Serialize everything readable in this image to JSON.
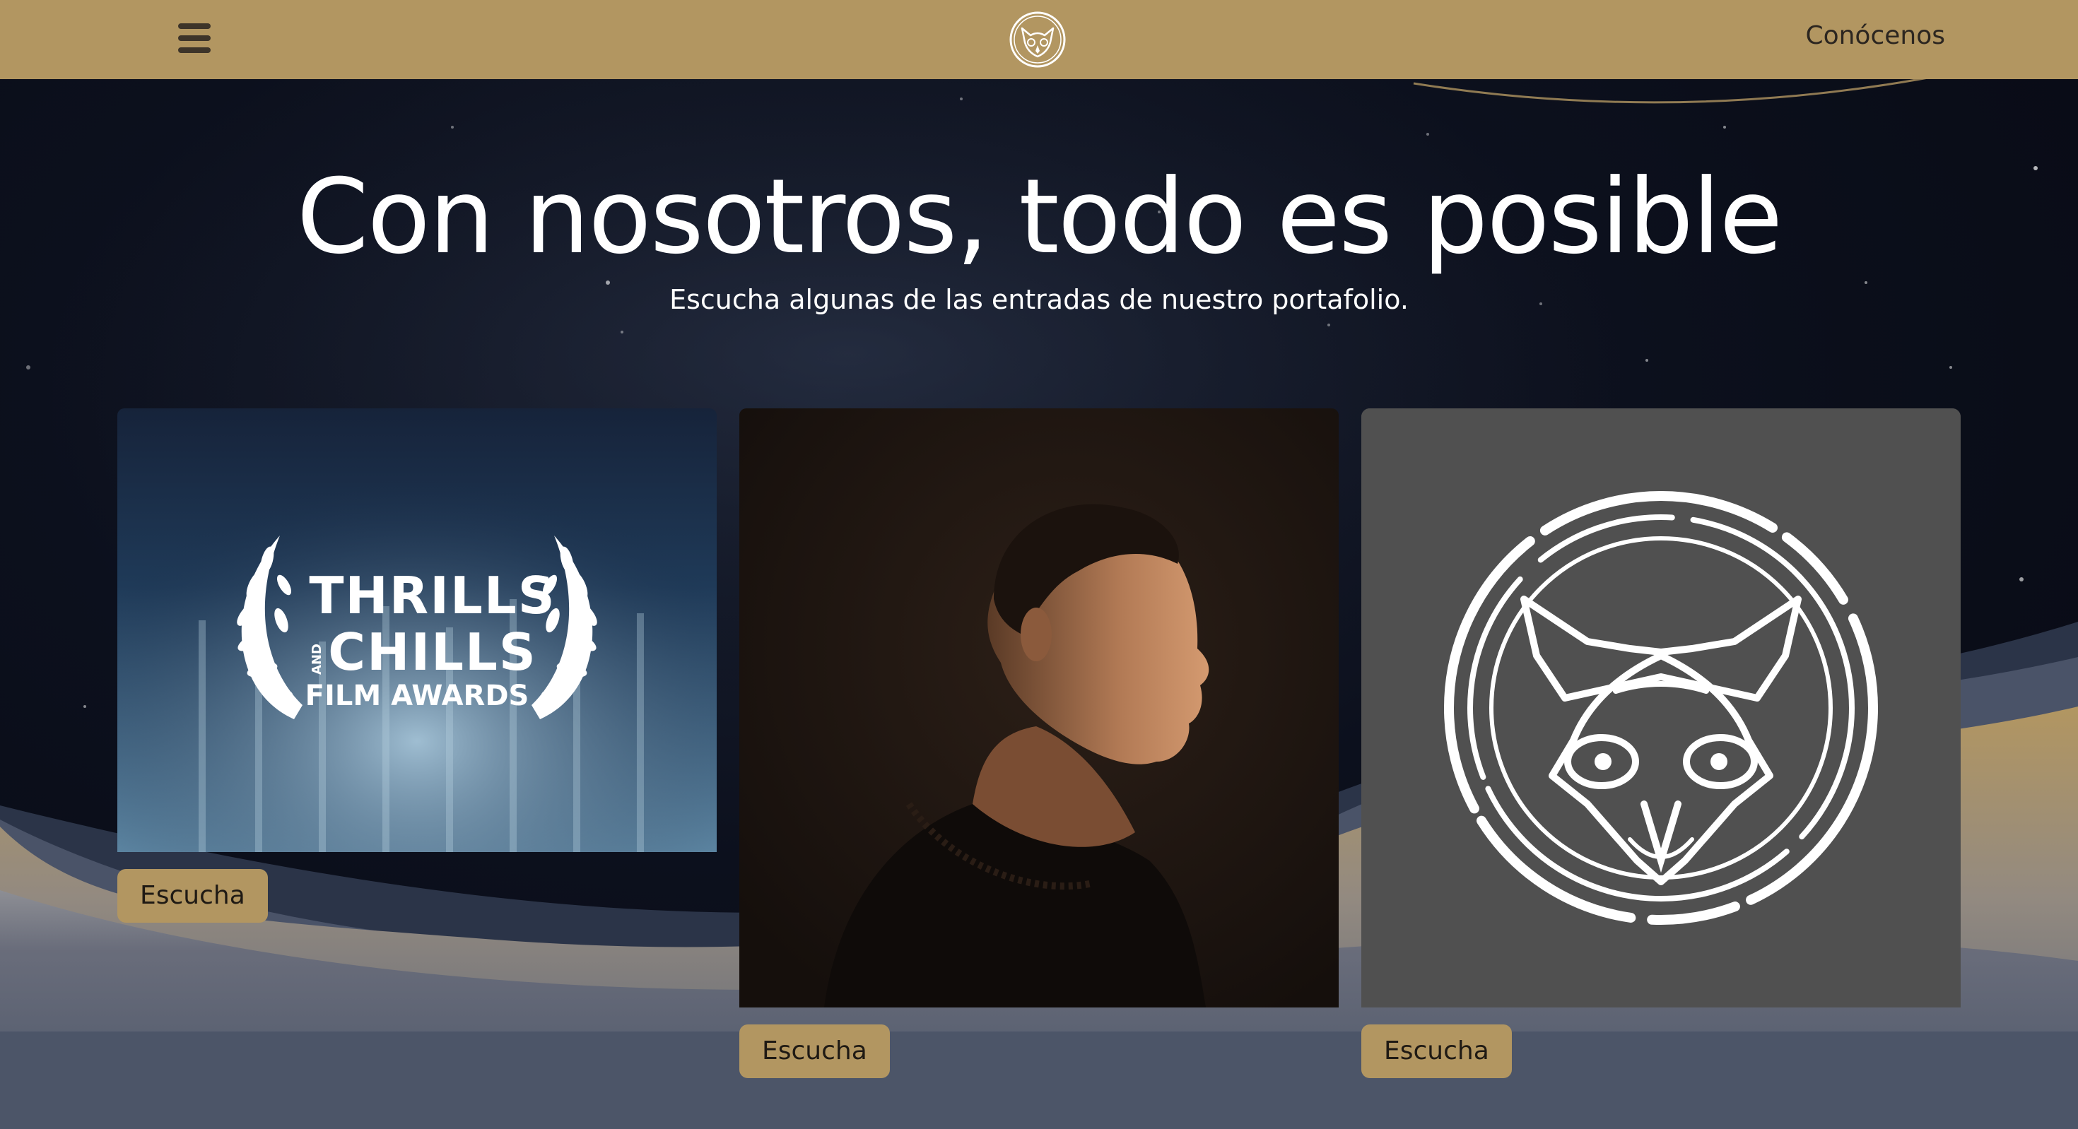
{
  "navbar": {
    "menu_icon": "hamburger-menu-icon",
    "logo_icon": "owl-logo-icon",
    "about_link": "Conócenos"
  },
  "hero": {
    "title": "Con nosotros, todo es posible",
    "subtitle": "Escucha algunas de las entradas de nuestro portafolio."
  },
  "cards": [
    {
      "image_icon": "thrills-and-chills-laurel-icon",
      "laurel_line1": "THRILLS",
      "laurel_and": "AND",
      "laurel_line2": "CHILLS",
      "laurel_line3": "FILM AWARDS",
      "button": "Escucha"
    },
    {
      "image_icon": "man-profile-portrait-icon",
      "button": "Escucha"
    },
    {
      "image_icon": "owl-emblem-icon",
      "button": "Escucha"
    }
  ],
  "colors": {
    "accent_gold": "#b29661",
    "navbar_text": "#2c2620",
    "hero_text": "#ffffff",
    "page_dark": "#0a0c17",
    "lower_slate": "#4d5769",
    "owl_card_bg": "#505050"
  }
}
